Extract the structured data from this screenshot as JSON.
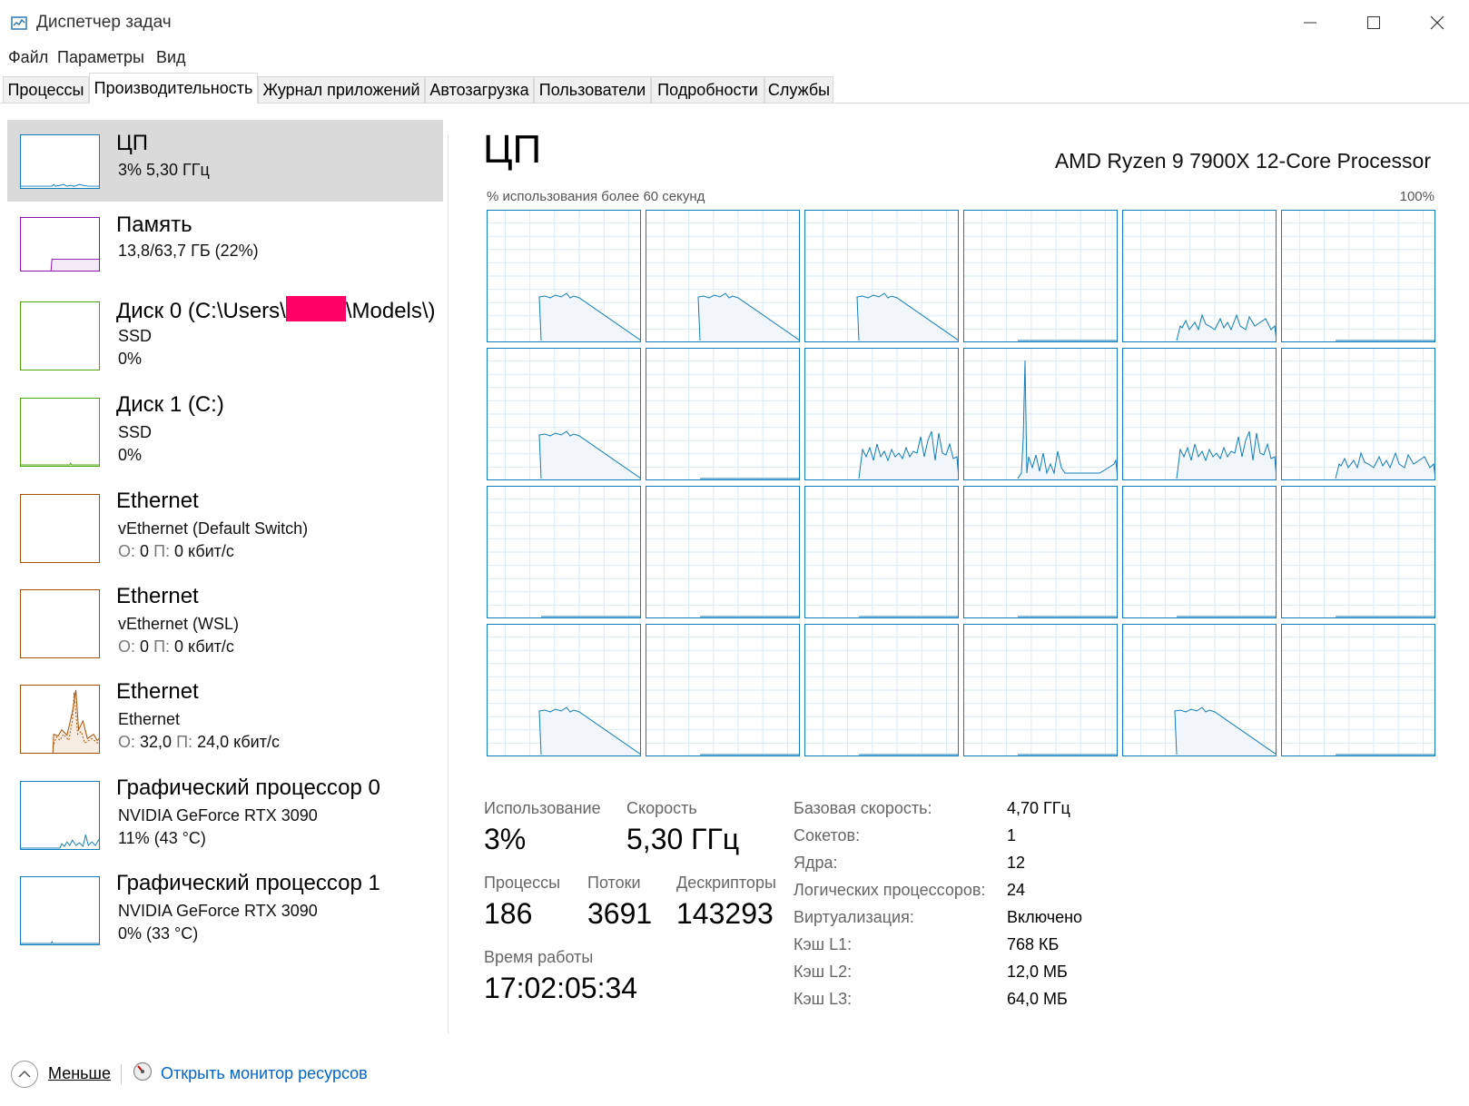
{
  "window": {
    "title": "Диспетчер задач"
  },
  "menu": [
    "Файл",
    "Параметры",
    "Вид"
  ],
  "tabs": [
    "Процессы",
    "Производительность",
    "Журнал приложений",
    "Автозагрузка",
    "Пользователи",
    "Подробности",
    "Службы"
  ],
  "active_tab": "Производительность",
  "sidebar": {
    "items": [
      {
        "title": "ЦП",
        "line1": "3%  5,30 ГГц",
        "line2": "",
        "color": "#117dbb",
        "selected": true
      },
      {
        "title": "Память",
        "line1": "13,8/63,7 ГБ (22%)",
        "line2": "",
        "color": "#8b12ae",
        "selected": false
      },
      {
        "title_prefix": "Диск 0 (C:\\Users\\",
        "title_suffix": "\\Models\\)",
        "line1": "SSD",
        "line2": "0%",
        "color": "#4da60c",
        "selected": false
      },
      {
        "title": "Диск 1 (C:)",
        "line1": "SSD",
        "line2": "0%",
        "color": "#4da60c",
        "selected": false
      },
      {
        "title": "Ethernet",
        "line1": "vEthernet (Default Switch)",
        "send_label": "О:",
        "send": "0",
        "recv_label": "П:",
        "recv": "0 кбит/с",
        "color": "#a74f01",
        "selected": false
      },
      {
        "title": "Ethernet",
        "line1": "vEthernet (WSL)",
        "send_label": "О:",
        "send": "0",
        "recv_label": "П:",
        "recv": "0 кбит/с",
        "color": "#a74f01",
        "selected": false
      },
      {
        "title": "Ethernet",
        "line1": "Ethernet",
        "send_label": "О:",
        "send": "32,0",
        "recv_label": "П:",
        "recv": "24,0 кбит/с",
        "color": "#a74f01",
        "selected": false
      },
      {
        "title": "Графический процессор 0",
        "line1": "NVIDIA GeForce RTX 3090",
        "line2": "11%  (43 °C)",
        "color": "#117dbb",
        "selected": false
      },
      {
        "title": "Графический процессор 1",
        "line1": "NVIDIA GeForce RTX 3090",
        "line2": "0%  (33 °C)",
        "color": "#117dbb",
        "selected": false
      }
    ]
  },
  "main": {
    "title": "ЦП",
    "cpu_model": "AMD Ryzen 9 7900X 12-Core Processor",
    "graph_caption": "% использования более 60 секунд",
    "graph_max": "100%",
    "graph_color": "#117dbb",
    "core_activity": [
      "low",
      "low",
      "low",
      "none",
      "med",
      "none",
      "low",
      "none",
      "high",
      "spike",
      "high",
      "med",
      "none",
      "none",
      "none",
      "none",
      "none",
      "none",
      "low",
      "none",
      "none",
      "none",
      "low",
      "none"
    ]
  },
  "stats": {
    "usage_label": "Использование",
    "usage_value": "3%",
    "speed_label": "Скорость",
    "speed_value": "5,30 ГГц",
    "processes_label": "Процессы",
    "processes_value": "186",
    "threads_label": "Потоки",
    "threads_value": "3691",
    "handles_label": "Дескрипторы",
    "handles_value": "143293",
    "uptime_label": "Время работы",
    "uptime_value": "17:02:05:34"
  },
  "info": [
    {
      "label": "Базовая скорость:",
      "value": "4,70 ГГц"
    },
    {
      "label": "Сокетов:",
      "value": "1"
    },
    {
      "label": "Ядра:",
      "value": "12"
    },
    {
      "label": "Логических процессоров:",
      "value": "24"
    },
    {
      "label": "Виртуализация:",
      "value": "Включено"
    },
    {
      "label": "Кэш L1:",
      "value": "768 КБ"
    },
    {
      "label": "Кэш L2:",
      "value": "12,0 МБ"
    },
    {
      "label": "Кэш L3:",
      "value": "64,0 МБ"
    }
  ],
  "footer": {
    "less_label": "Меньше",
    "resource_monitor": "Открыть монитор ресурсов"
  }
}
